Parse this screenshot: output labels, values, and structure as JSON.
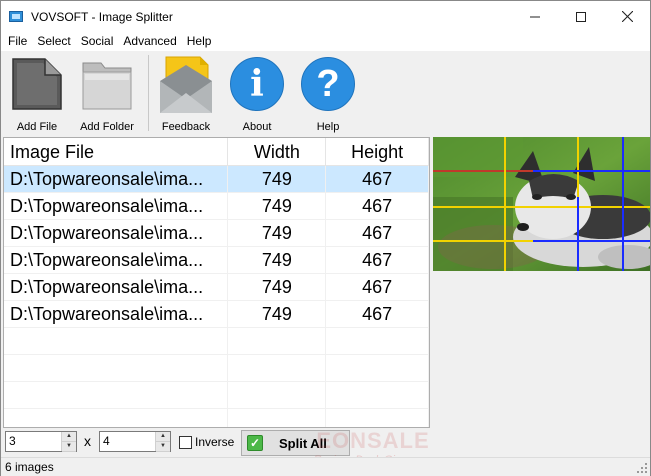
{
  "window": {
    "title": "VOVSOFT - Image Splitter",
    "minimize_icon": "minimize-icon",
    "maximize_icon": "maximize-icon",
    "close_icon": "close-icon"
  },
  "menu": [
    "File",
    "Select",
    "Social",
    "Advanced",
    "Help"
  ],
  "toolbar": {
    "add_file": "Add File",
    "add_folder": "Add Folder",
    "feedback": "Feedback",
    "about": "About",
    "help": "Help"
  },
  "list": {
    "columns": [
      "Image File",
      "Width",
      "Height"
    ],
    "rows": [
      [
        "D:\\Topwareonsale\\ima...",
        "749",
        "467"
      ],
      [
        "D:\\Topwareonsale\\ima...",
        "749",
        "467"
      ],
      [
        "D:\\Topwareonsale\\ima...",
        "749",
        "467"
      ],
      [
        "D:\\Topwareonsale\\ima...",
        "749",
        "467"
      ],
      [
        "D:\\Topwareonsale\\ima...",
        "749",
        "467"
      ],
      [
        "D:\\Topwareonsale\\ima...",
        "749",
        "467"
      ]
    ],
    "selected_row": 0
  },
  "controls": {
    "rows_value": "3",
    "cols_value": "4",
    "x_label": "x",
    "inverse_label": "Inverse",
    "inverse_checked": false,
    "split_all_label": "Split All"
  },
  "status": {
    "text": "6 images"
  },
  "watermark": {
    "main": "EONSALE",
    "sub": "Review. Deal. Giveaway"
  },
  "colors": {
    "selection": "#cce8ff",
    "accent_blue": "#2b8ee0",
    "grid_yellow": "#f2d200",
    "grid_blue": "#1a2cff",
    "grid_red": "#c0392b"
  }
}
